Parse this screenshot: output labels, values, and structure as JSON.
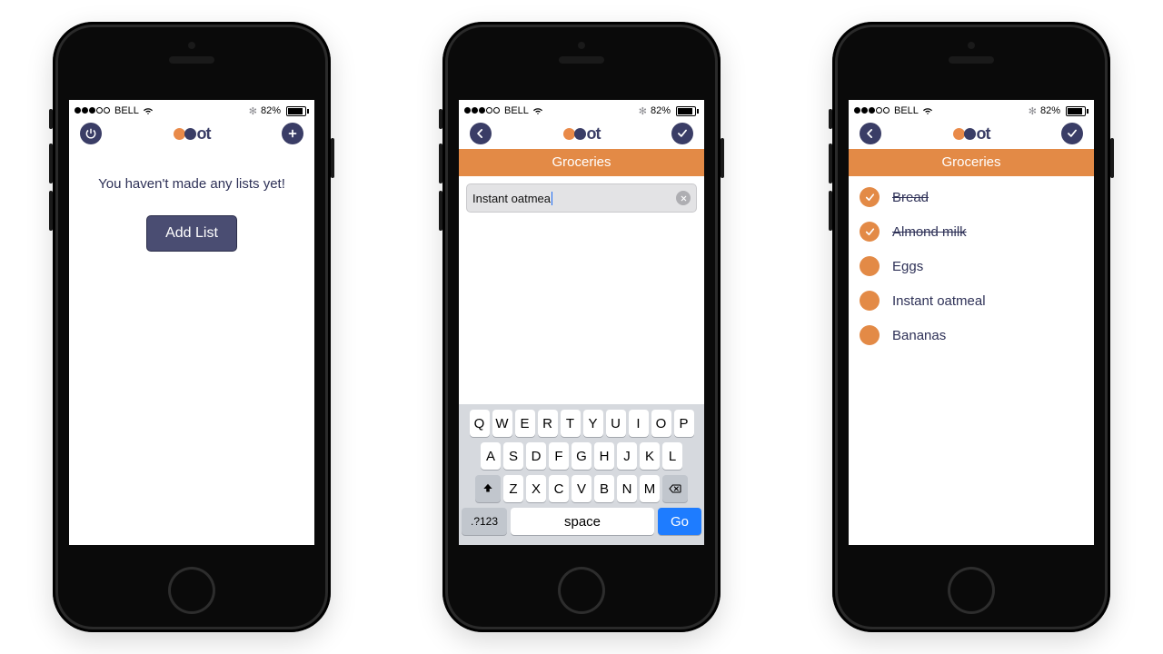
{
  "status": {
    "carrier": "BELL",
    "battery_pct": "82%",
    "bluetooth": "bt"
  },
  "logo_text": "ot",
  "screen1": {
    "empty_msg": "You haven't made any lists yet!",
    "add_list": "Add List"
  },
  "screen2": {
    "category": "Groceries",
    "input_value": "Instant oatmea",
    "keyboard": {
      "row1": [
        "Q",
        "W",
        "E",
        "R",
        "T",
        "Y",
        "U",
        "I",
        "O",
        "P"
      ],
      "row2": [
        "A",
        "S",
        "D",
        "F",
        "G",
        "H",
        "J",
        "K",
        "L"
      ],
      "row3": [
        "Z",
        "X",
        "C",
        "V",
        "B",
        "N",
        "M"
      ],
      "numkey": ".?123",
      "space": "space",
      "go": "Go"
    }
  },
  "screen3": {
    "category": "Groceries",
    "items": [
      {
        "label": "Bread",
        "done": true
      },
      {
        "label": "Almond milk",
        "done": true
      },
      {
        "label": "Eggs",
        "done": false
      },
      {
        "label": "Instant oatmeal",
        "done": false
      },
      {
        "label": "Bananas",
        "done": false
      }
    ]
  }
}
